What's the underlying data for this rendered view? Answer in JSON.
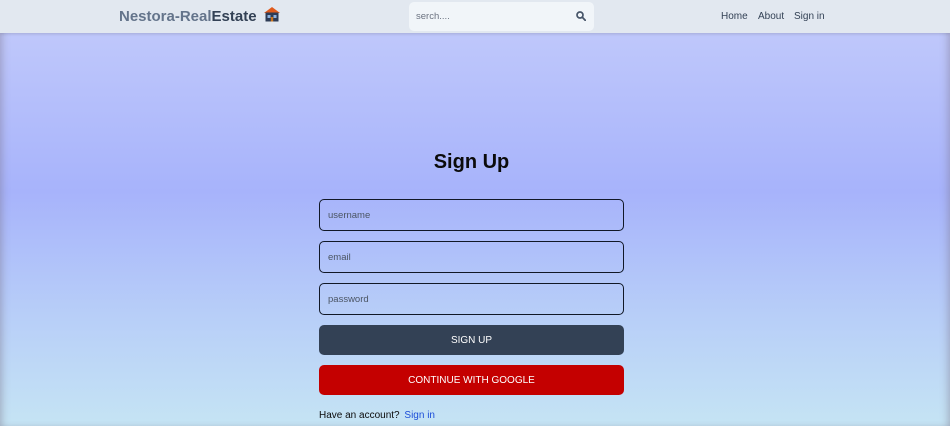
{
  "header": {
    "logo_part1": "Nestora-Real",
    "logo_part2": "Estate",
    "logo_icon": "house-icon",
    "search": {
      "placeholder": "serch....",
      "icon": "search-icon"
    },
    "nav": {
      "home": "Home",
      "about": "About",
      "sign_in": "Sign in"
    }
  },
  "form": {
    "title": "Sign Up",
    "username_placeholder": "username",
    "email_placeholder": "email",
    "password_placeholder": "password",
    "signup_label": "SIGN UP",
    "google_label": "CONTINUE WITH GOOGLE",
    "have_account_text": "Have an account?",
    "sign_in_link": "Sign in"
  },
  "colors": {
    "header_bg": "#e2e8f0",
    "logo_light": "#64748b",
    "logo_dark": "#334155",
    "signup_button": "#334155",
    "google_button": "#c40000",
    "link": "#1d4ed8"
  }
}
